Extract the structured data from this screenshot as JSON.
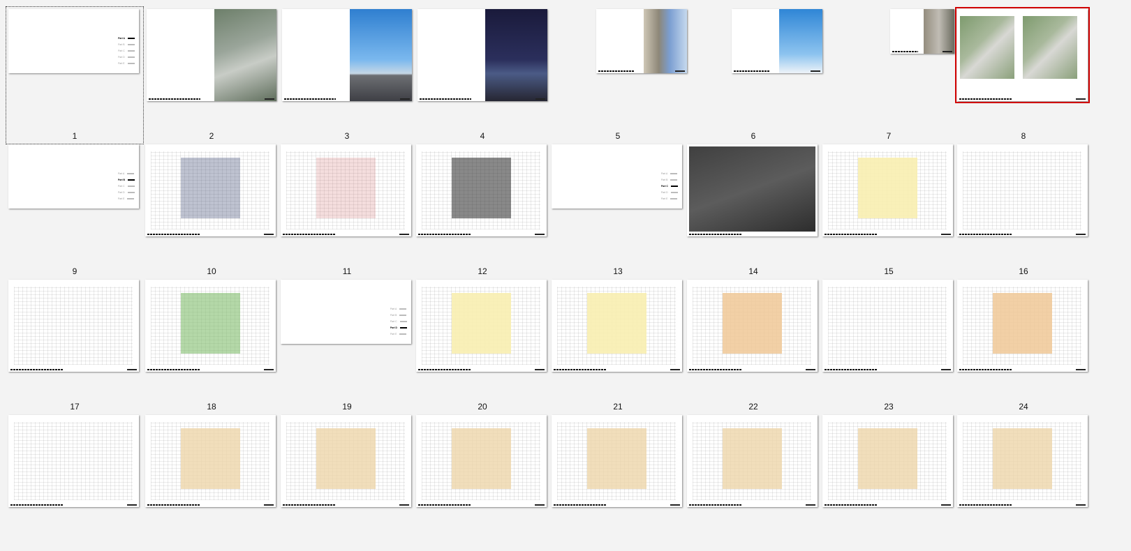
{
  "pages": [
    {
      "label": "1",
      "kind": "toc",
      "toc": [
        "Part A",
        "Part B",
        "Part C",
        "Part D",
        "Part E"
      ],
      "active": 0,
      "current": true
    },
    {
      "label": "2",
      "kind": "photo",
      "photo": "aerial"
    },
    {
      "label": "3",
      "kind": "photo",
      "photo": "sky"
    },
    {
      "label": "4",
      "kind": "photo",
      "photo": "night"
    },
    {
      "label": "5",
      "kind": "photo",
      "photo": "facade"
    },
    {
      "label": "6",
      "kind": "photo",
      "photo": "tower"
    },
    {
      "label": "7",
      "kind": "photo",
      "photo": "courtyard"
    },
    {
      "label": "8",
      "kind": "siteplan",
      "selected": true
    },
    {
      "label": "9",
      "kind": "toc",
      "toc": [
        "Part A",
        "Part B",
        "Part C",
        "Part D",
        "Part E"
      ],
      "active": 1
    },
    {
      "label": "10",
      "kind": "diagram",
      "variant": "massing"
    },
    {
      "label": "11",
      "kind": "diagram",
      "variant": "analysis"
    },
    {
      "label": "12",
      "kind": "diagram",
      "variant": "grid"
    },
    {
      "label": "13",
      "kind": "toc",
      "toc": [
        "Part A",
        "Part B",
        "Part C",
        "Part D",
        "Part E"
      ],
      "active": 2
    },
    {
      "label": "14",
      "kind": "map"
    },
    {
      "label": "15",
      "kind": "plan",
      "variant": "site-yellow"
    },
    {
      "label": "16",
      "kind": "plan",
      "variant": "site-color"
    },
    {
      "label": "17",
      "kind": "plan",
      "variant": "line4"
    },
    {
      "label": "18",
      "kind": "plan",
      "variant": "line4-green"
    },
    {
      "label": "19",
      "kind": "toc",
      "toc": [
        "Part A",
        "Part B",
        "Part C",
        "Part D",
        "Part E"
      ],
      "active": 3
    },
    {
      "label": "20",
      "kind": "plan",
      "variant": "ground-yellow"
    },
    {
      "label": "21",
      "kind": "plan",
      "variant": "ground-yellow"
    },
    {
      "label": "22",
      "kind": "plan",
      "variant": "basement-orange"
    },
    {
      "label": "23",
      "kind": "plan",
      "variant": "basement-white"
    },
    {
      "label": "24",
      "kind": "plan",
      "variant": "basement-orange"
    },
    {
      "label": "",
      "kind": "plan",
      "variant": "basement-white"
    },
    {
      "label": "",
      "kind": "plan",
      "variant": "floor"
    },
    {
      "label": "",
      "kind": "plan",
      "variant": "floor"
    },
    {
      "label": "",
      "kind": "plan",
      "variant": "floor"
    },
    {
      "label": "",
      "kind": "plan",
      "variant": "floor"
    },
    {
      "label": "",
      "kind": "plan",
      "variant": "floor"
    },
    {
      "label": "",
      "kind": "plan",
      "variant": "floor"
    },
    {
      "label": "",
      "kind": "plan",
      "variant": "floor"
    }
  ],
  "colors": {
    "selection": "#d00000",
    "background": "#f3f3f3"
  }
}
